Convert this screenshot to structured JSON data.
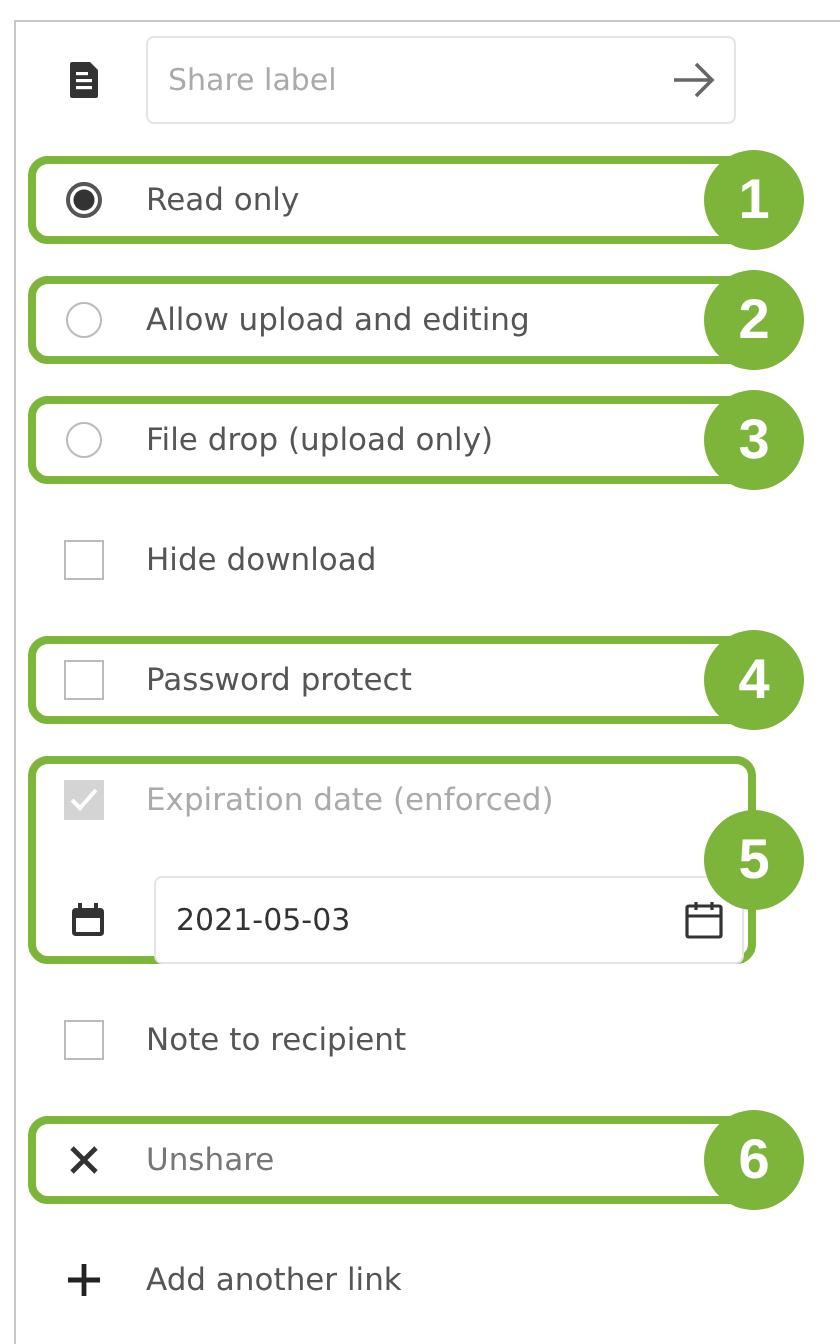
{
  "groups": [
    {
      "rows": [
        {
          "kind": "text-field",
          "placeholder": "Share label"
        }
      ]
    },
    {
      "callout": "1",
      "rows": [
        {
          "kind": "radio",
          "label": "Read only",
          "selected": true
        }
      ]
    },
    {
      "callout": "2",
      "rows": [
        {
          "kind": "radio",
          "label": "Allow upload and editing",
          "selected": false
        }
      ]
    },
    {
      "callout": "3",
      "rows": [
        {
          "kind": "radio",
          "label": "File drop (upload only)",
          "selected": false
        }
      ]
    },
    {
      "rows": [
        {
          "kind": "checkbox",
          "label": "Hide download",
          "checked": false,
          "disabled": false
        }
      ]
    },
    {
      "callout": "4",
      "rows": [
        {
          "kind": "checkbox",
          "label": "Password protect",
          "checked": false,
          "disabled": false
        }
      ]
    },
    {
      "callout": "5",
      "rows": [
        {
          "kind": "checkbox",
          "label": "Expiration date (enforced)",
          "checked": true,
          "disabled": true
        },
        {
          "kind": "date-field",
          "value": "2021-05-03"
        }
      ]
    },
    {
      "rows": [
        {
          "kind": "checkbox",
          "label": "Note to recipient",
          "checked": false,
          "disabled": false
        }
      ]
    },
    {
      "callout": "6",
      "rows": [
        {
          "kind": "remove-action",
          "label": "Unshare"
        }
      ]
    },
    {
      "rows": [
        {
          "kind": "add-action",
          "label": "Add another link"
        }
      ]
    }
  ]
}
